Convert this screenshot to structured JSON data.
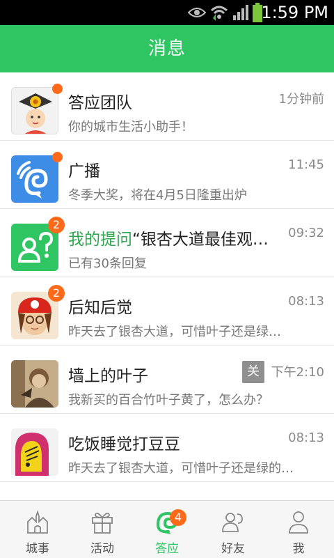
{
  "status_bar": {
    "time": "1:59 PM",
    "icons": [
      "eye-icon",
      "wifi-icon",
      "signal-icon",
      "battery-icon"
    ]
  },
  "header": {
    "title": "消息"
  },
  "messages": [
    {
      "title": "答应团队",
      "subtitle": "你的城市生活小助手！",
      "time": "1分钟前",
      "badge": "dot",
      "avatar": "team-avatar"
    },
    {
      "title": "广播",
      "subtitle": "冬季大奖，将在4月5日隆重出炉",
      "time": "11:45",
      "badge": "dot",
      "avatar": "broadcast-avatar"
    },
    {
      "title_highlight": "我的提问",
      "title_rest": "“银杏大道最佳观赏…",
      "subtitle": "已有30条回复",
      "time": "09:32",
      "badge_count": "2",
      "avatar": "question-avatar"
    },
    {
      "title": "后知后觉",
      "subtitle": "昨天去了银杏大道，可惜叶子还是绿…",
      "time": "08:13",
      "badge_count": "2",
      "avatar": "girl-avatar"
    },
    {
      "title": "墙上的叶子",
      "subtitle": "我新买的百合竹叶子黄了，怎么办？",
      "time": "下午2:10",
      "tag": "关",
      "avatar": "photo-avatar"
    },
    {
      "title": "吃饭睡觉打豆豆",
      "subtitle": "昨天去了银杏大道，可惜叶子还是绿的…",
      "time": "08:13",
      "avatar": "hoodie-avatar"
    }
  ],
  "tabs": [
    {
      "label": "城事",
      "icon": "castle-icon",
      "active": false
    },
    {
      "label": "活动",
      "icon": "gift-icon",
      "active": false
    },
    {
      "label": "答应",
      "icon": "chat-bubble-icon",
      "active": true,
      "badge": "4"
    },
    {
      "label": "好友",
      "icon": "friends-icon",
      "active": false
    },
    {
      "label": "我",
      "icon": "person-icon",
      "active": false
    }
  ],
  "colors": {
    "brand_green": "#2fc563",
    "badge_orange": "#ff6a1a",
    "broadcast_blue": "#3d8de6"
  }
}
